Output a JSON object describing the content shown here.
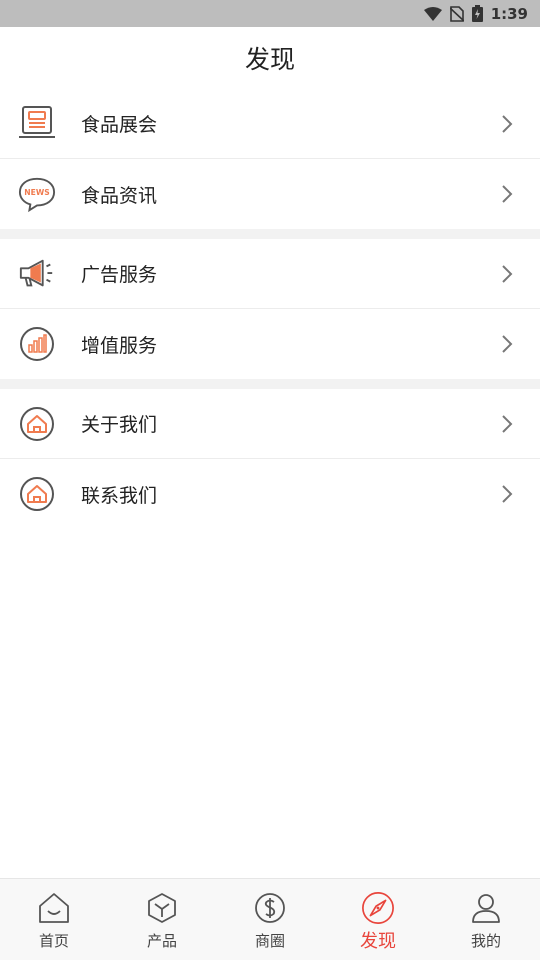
{
  "status_bar": {
    "time": "1:39"
  },
  "header": {
    "title": "发现"
  },
  "menu": {
    "items": [
      {
        "label": "食品展会",
        "icon": "exhibition-icon"
      },
      {
        "label": "食品资讯",
        "icon": "news-icon",
        "icon_text": "NEWS"
      },
      {
        "label": "广告服务",
        "icon": "megaphone-icon"
      },
      {
        "label": "增值服务",
        "icon": "chart-icon"
      },
      {
        "label": "关于我们",
        "icon": "home-icon"
      },
      {
        "label": "联系我们",
        "icon": "home-icon"
      }
    ]
  },
  "tabs": [
    {
      "label": "首页",
      "icon": "home-tab-icon"
    },
    {
      "label": "产品",
      "icon": "product-cube-icon"
    },
    {
      "label": "商圈",
      "icon": "dollar-icon"
    },
    {
      "label": "发现",
      "icon": "compass-icon",
      "active": true
    },
    {
      "label": "我的",
      "icon": "user-icon"
    }
  ],
  "colors": {
    "accent": "#e8453c",
    "icon_orange": "#f07b4f",
    "icon_gray": "#555555"
  }
}
